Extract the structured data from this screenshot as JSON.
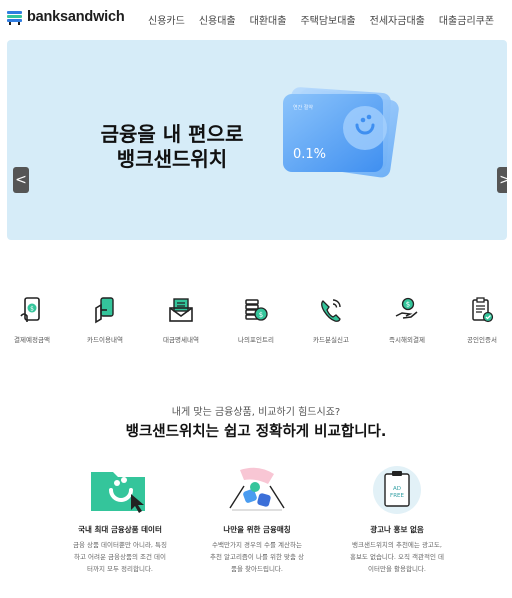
{
  "header": {
    "logo_text": "banksandwich",
    "nav": [
      "신용카드",
      "신용대출",
      "대환대출",
      "주택담보대출",
      "전세자금대출",
      "대출금리쿠폰"
    ]
  },
  "hero": {
    "title_line1": "금융을 내 편으로",
    "title_line2": "뱅크샌드위치",
    "card_small_text": "연간 절약",
    "card_rate": "0.1%",
    "prev_label": "<",
    "next_label": ">"
  },
  "quick_menu": [
    {
      "label": "결제예정금액",
      "icon": "phone-payment-icon"
    },
    {
      "label": "카드이용내역",
      "icon": "card-hand-icon"
    },
    {
      "label": "대금명세내역",
      "icon": "statement-mail-icon"
    },
    {
      "label": "나의포인트리",
      "icon": "coin-stack-icon"
    },
    {
      "label": "카드분실신고",
      "icon": "phone-call-icon"
    },
    {
      "label": "즉시해외결제",
      "icon": "money-hand-icon"
    },
    {
      "label": "공인인증서",
      "icon": "clipboard-check-icon"
    }
  ],
  "intro": {
    "sub": "내게 맞는 금융상품, 비교하기 힘드시죠?",
    "main": "뱅크샌드위치는 쉽고 정확하게 비교합니다."
  },
  "features": [
    {
      "title": "국내 최대 금융상품 데이터",
      "desc": "금융 상품 데이터뿐만 아니라, 특징\n하고 어려운 금융상품의 조건 데이\n터까지 모두 정리합니다."
    },
    {
      "title": "나만을 위한 금융매칭",
      "desc": "수백만가지 경우의 수를 계산하는\n추천 알고리즘이 나를 위한 맞춤 상\n품을 찾아드립니다."
    },
    {
      "title": "광고나 홍보 없음",
      "desc": "뱅크샌드위치의 추천에는 광고도,\n홍보도 없습니다. 오직 객관적인 데\n이터만을 활용합니다."
    }
  ],
  "ad_free_badge": {
    "line1": "AD",
    "line2": "FREE"
  },
  "colors": {
    "accent_green": "#34c59b",
    "hero_bg": "#d6ecf8",
    "card_blue": "#4a9cf0"
  }
}
